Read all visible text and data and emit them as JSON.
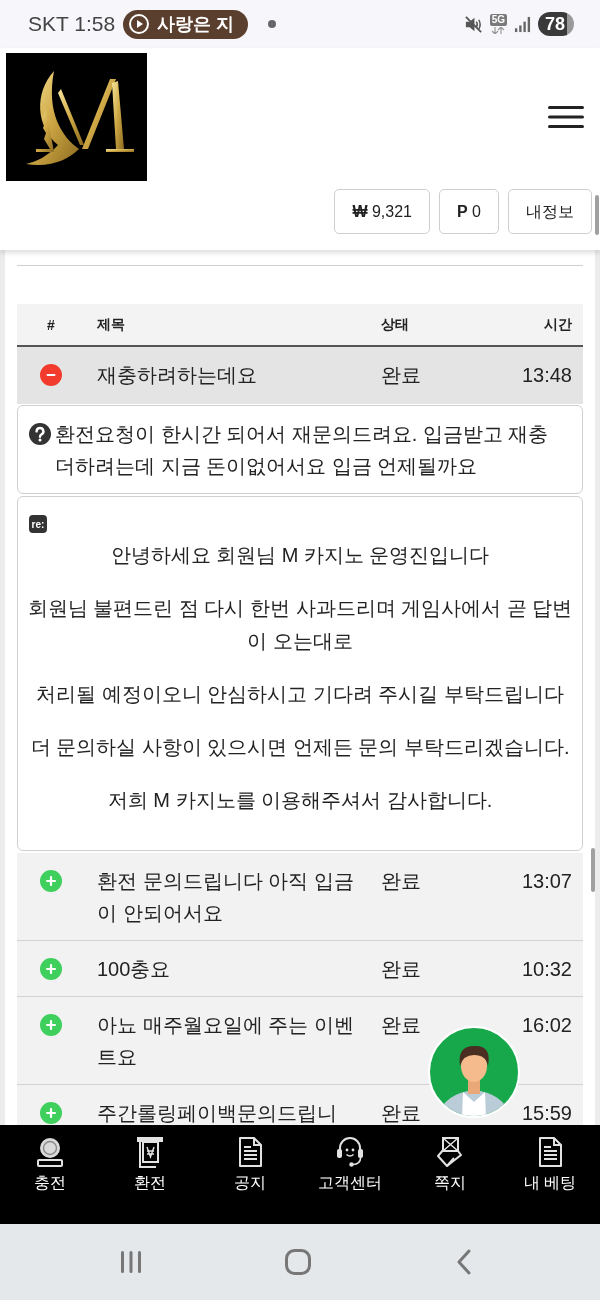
{
  "status_bar": {
    "carrier_time": "SKT 1:58",
    "media_title": "사랑은 지",
    "network": "5G",
    "battery": "78"
  },
  "header": {
    "account_buttons": [
      "**₩** 9,321",
      "**P** 0",
      "내정보"
    ]
  },
  "inquiries": {
    "columns": [
      "#",
      "제목",
      "상태",
      "시간"
    ],
    "rows": [
      {
        "expanded": true,
        "title": "재충하려하는데요",
        "status": "완료",
        "time": "13:48",
        "question": "환전요청이 한시간 되어서 재문의드려요. 입금받고 재충더하려는데 지금 돈이없어서요 입금 언제될까요",
        "reply_badge": "re:",
        "answer": [
          "안녕하세요 회원님 M 카지노 운영진입니다",
          "회원님 불편드린 점 다시 한번 사과드리며 게임사에서 곧 답변이 오는대로",
          "처리될 예정이오니 안심하시고 기다려 주시길 부탁드립니다",
          "더 문의하실 사항이 있으시면 언제든 문의 부탁드리겠습니다.",
          "저희 M 카지노를 이용해주셔서 감사합니다."
        ]
      },
      {
        "expanded": false,
        "title": "환전 문의드립니다 아직 입금이 안되어서요",
        "status": "완료",
        "time": "13:07"
      },
      {
        "expanded": false,
        "title": "100충요",
        "status": "완료",
        "time": "10:32"
      },
      {
        "expanded": false,
        "title": "아뇨 매주월요일에 주는 이벤트요",
        "status": "완료",
        "time": "16:02"
      },
      {
        "expanded": false,
        "title": "주간롤링페이백문의드립니",
        "status": "완료",
        "time": "15:59"
      }
    ]
  },
  "bottom_nav": [
    {
      "kind": "deposit",
      "label": "충전"
    },
    {
      "kind": "withdraw",
      "label": "환전"
    },
    {
      "kind": "notice",
      "label": "공지"
    },
    {
      "kind": "support",
      "label": "고객센터"
    },
    {
      "kind": "message",
      "label": "쪽지"
    },
    {
      "kind": "bets",
      "label": "내 베팅"
    }
  ]
}
